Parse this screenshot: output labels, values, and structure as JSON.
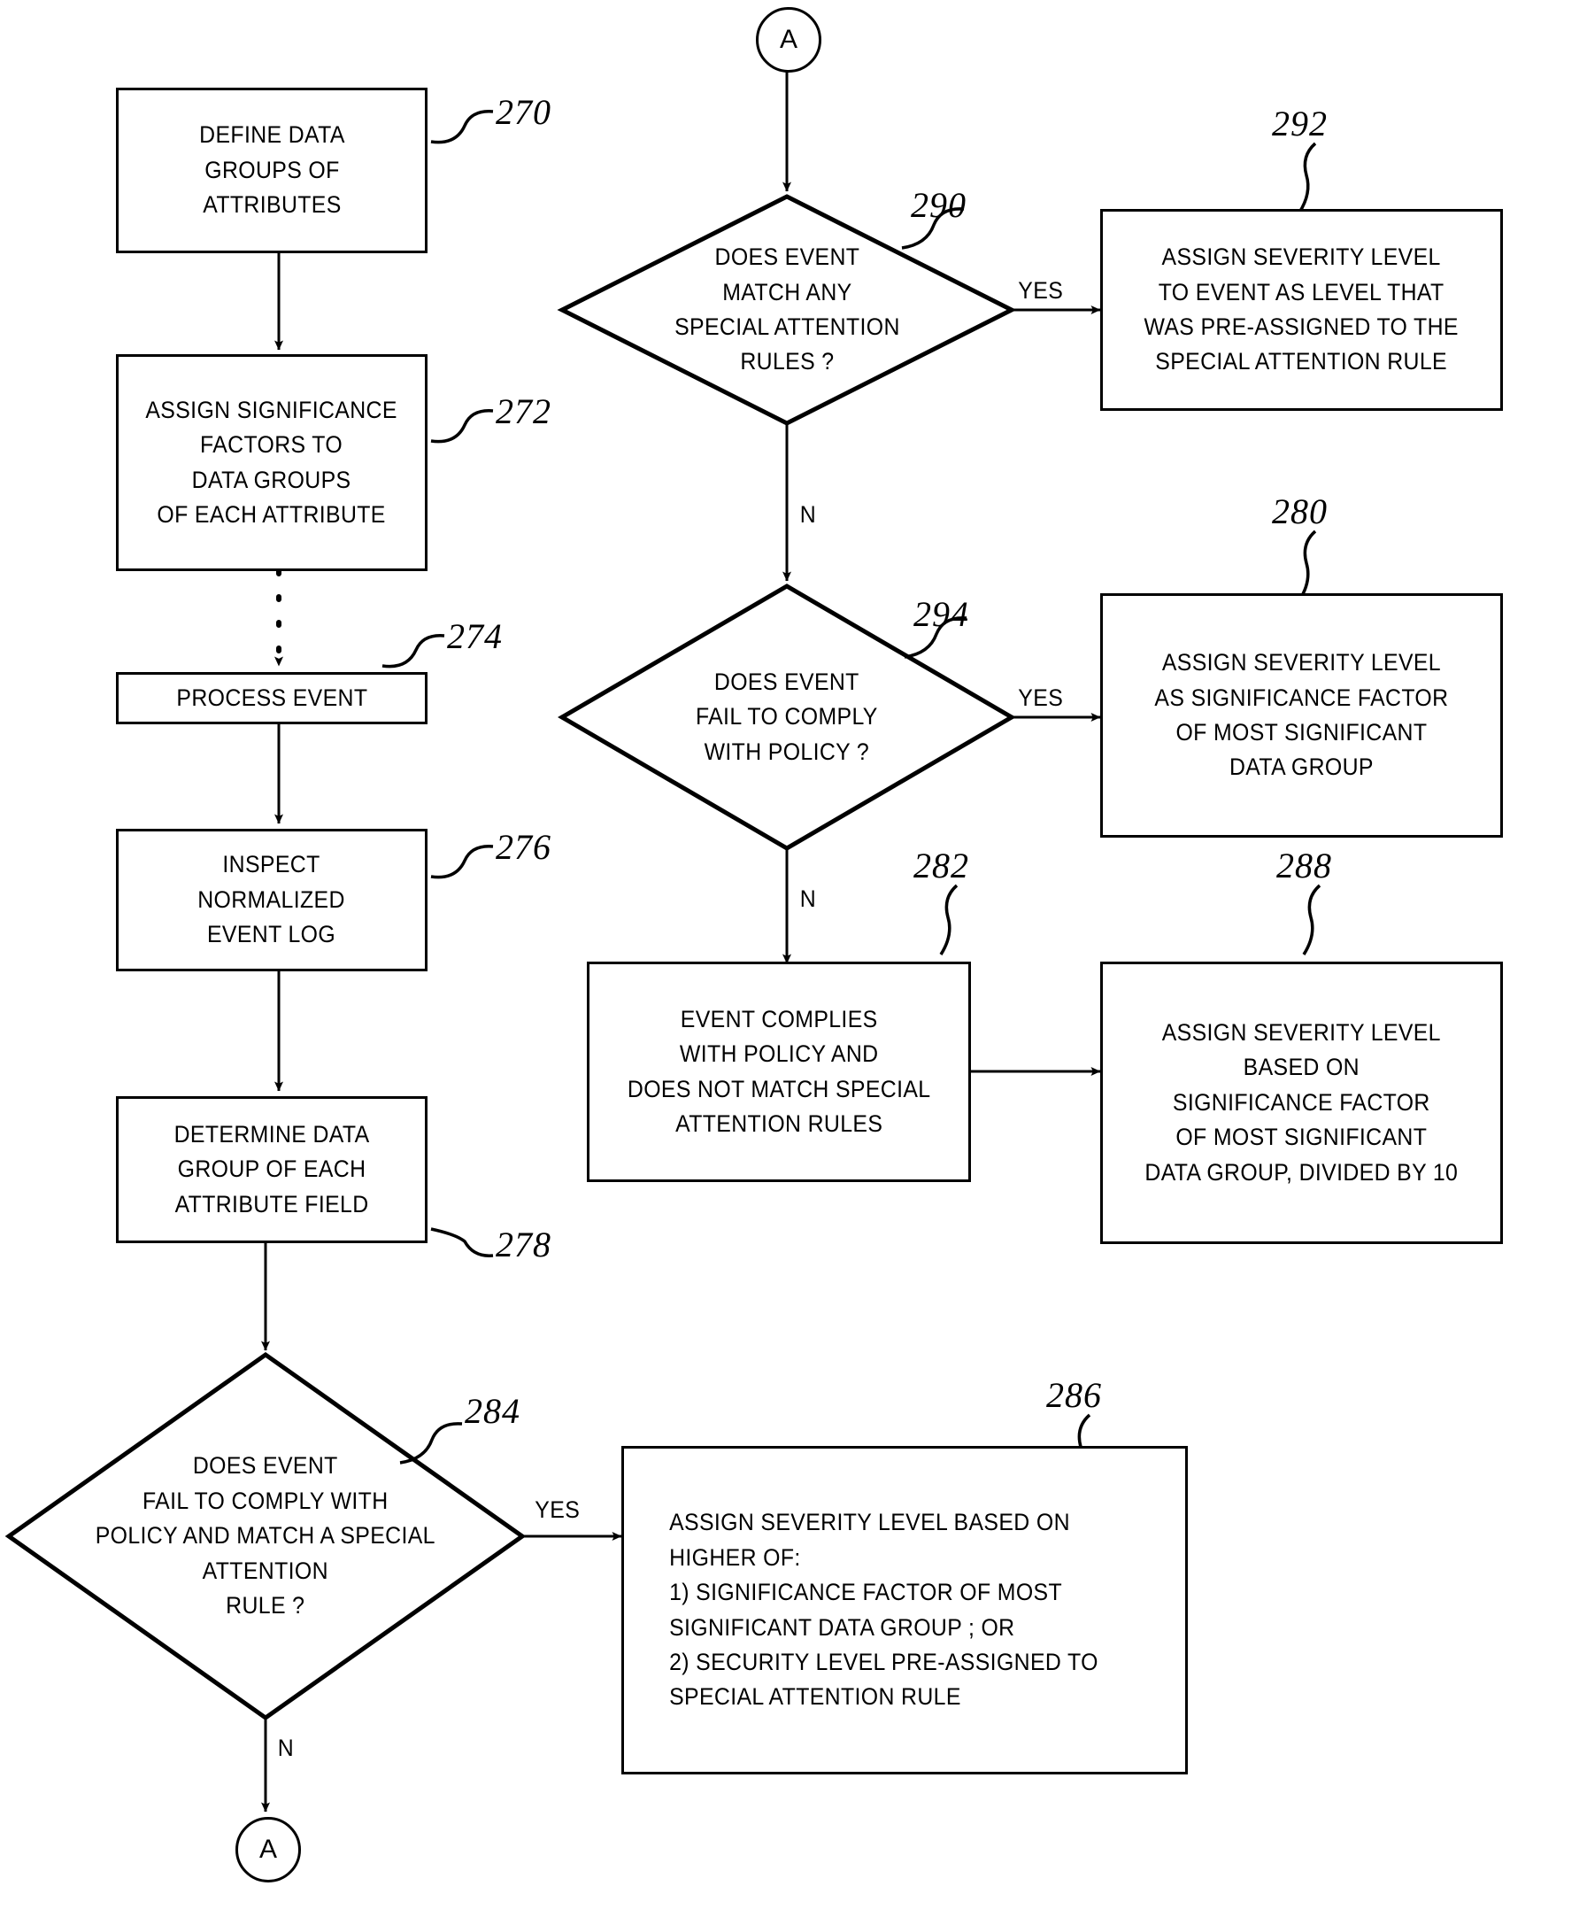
{
  "figure": {
    "type": "patent-flowchart",
    "connectors": [
      {
        "id": "connector-a-top",
        "label": "A"
      },
      {
        "id": "connector-a-bottom",
        "label": "A"
      }
    ],
    "process_boxes": [
      {
        "id": "box-270",
        "ref": "270",
        "text": "DEFINE DATA\nGROUPS OF\nATTRIBUTES"
      },
      {
        "id": "box-272",
        "ref": "272",
        "text": "ASSIGN SIGNIFICANCE\nFACTORS TO\nDATA GROUPS\nOF EACH ATTRIBUTE"
      },
      {
        "id": "box-274",
        "ref": "274",
        "text": "PROCESS EVENT"
      },
      {
        "id": "box-276",
        "ref": "276",
        "text": "INSPECT\nNORMALIZED\nEVENT LOG"
      },
      {
        "id": "box-278",
        "ref": "278",
        "text": "DETERMINE DATA\nGROUP OF EACH\nATTRIBUTE FIELD"
      },
      {
        "id": "box-286",
        "ref": "286",
        "text": "ASSIGN SEVERITY LEVEL BASED ON\nHIGHER OF:\n1) SIGNIFICANCE FACTOR OF MOST\n     SIGNIFICANT DATA GROUP ; OR\n2) SECURITY LEVEL PRE-ASSIGNED TO\n     SPECIAL ATTENTION RULE"
      },
      {
        "id": "box-290",
        "ref": "290",
        "text": "ASSIGN SEVERITY LEVEL\nTO EVENT AS LEVEL THAT\nWAS PRE-ASSIGNED TO THE\nSPECIAL ATTENTION RULE"
      },
      {
        "id": "box-294",
        "ref": "294",
        "text": "ASSIGN SEVERITY LEVEL\nAS SIGNIFICANCE FACTOR\nOF MOST SIGNIFICANT\nDATA GROUP"
      },
      {
        "id": "box-280",
        "ref": "280",
        "text": "EVENT COMPLIES\nWITH POLICY AND\nDOES NOT MATCH SPECIAL\nATTENTION RULES"
      },
      {
        "id": "box-282",
        "ref": "282",
        "text": "ASSIGN SEVERITY LEVEL\nBASED ON\nSIGNIFICANCE FACTOR\nOF MOST SIGNIFICANT\nDATA GROUP, DIVIDED BY 10"
      }
    ],
    "decision_diamonds": [
      {
        "id": "diamond-288",
        "ref": "288",
        "text": "DOES EVENT\nMATCH ANY\nSPECIAL ATTENTION\nRULES ?"
      },
      {
        "id": "diamond-292",
        "ref": "292",
        "text": "DOES EVENT\nFAIL TO COMPLY\nWITH POLICY ?"
      },
      {
        "id": "diamond-284",
        "ref": "284",
        "text": "DOES EVENT\nFAIL TO COMPLY WITH\nPOLICY AND MATCH A SPECIAL\nATTENTION\nRULE ?"
      }
    ],
    "edge_labels": [
      {
        "id": "yes-288",
        "text": "YES"
      },
      {
        "id": "no-288",
        "text": "N"
      },
      {
        "id": "yes-292",
        "text": "YES"
      },
      {
        "id": "no-292",
        "text": "N"
      },
      {
        "id": "yes-284",
        "text": "YES"
      },
      {
        "id": "no-284",
        "text": "N"
      }
    ],
    "reference_numerals": [
      "270",
      "272",
      "274",
      "276",
      "278",
      "280",
      "282",
      "284",
      "286",
      "288",
      "290",
      "292",
      "294"
    ]
  }
}
